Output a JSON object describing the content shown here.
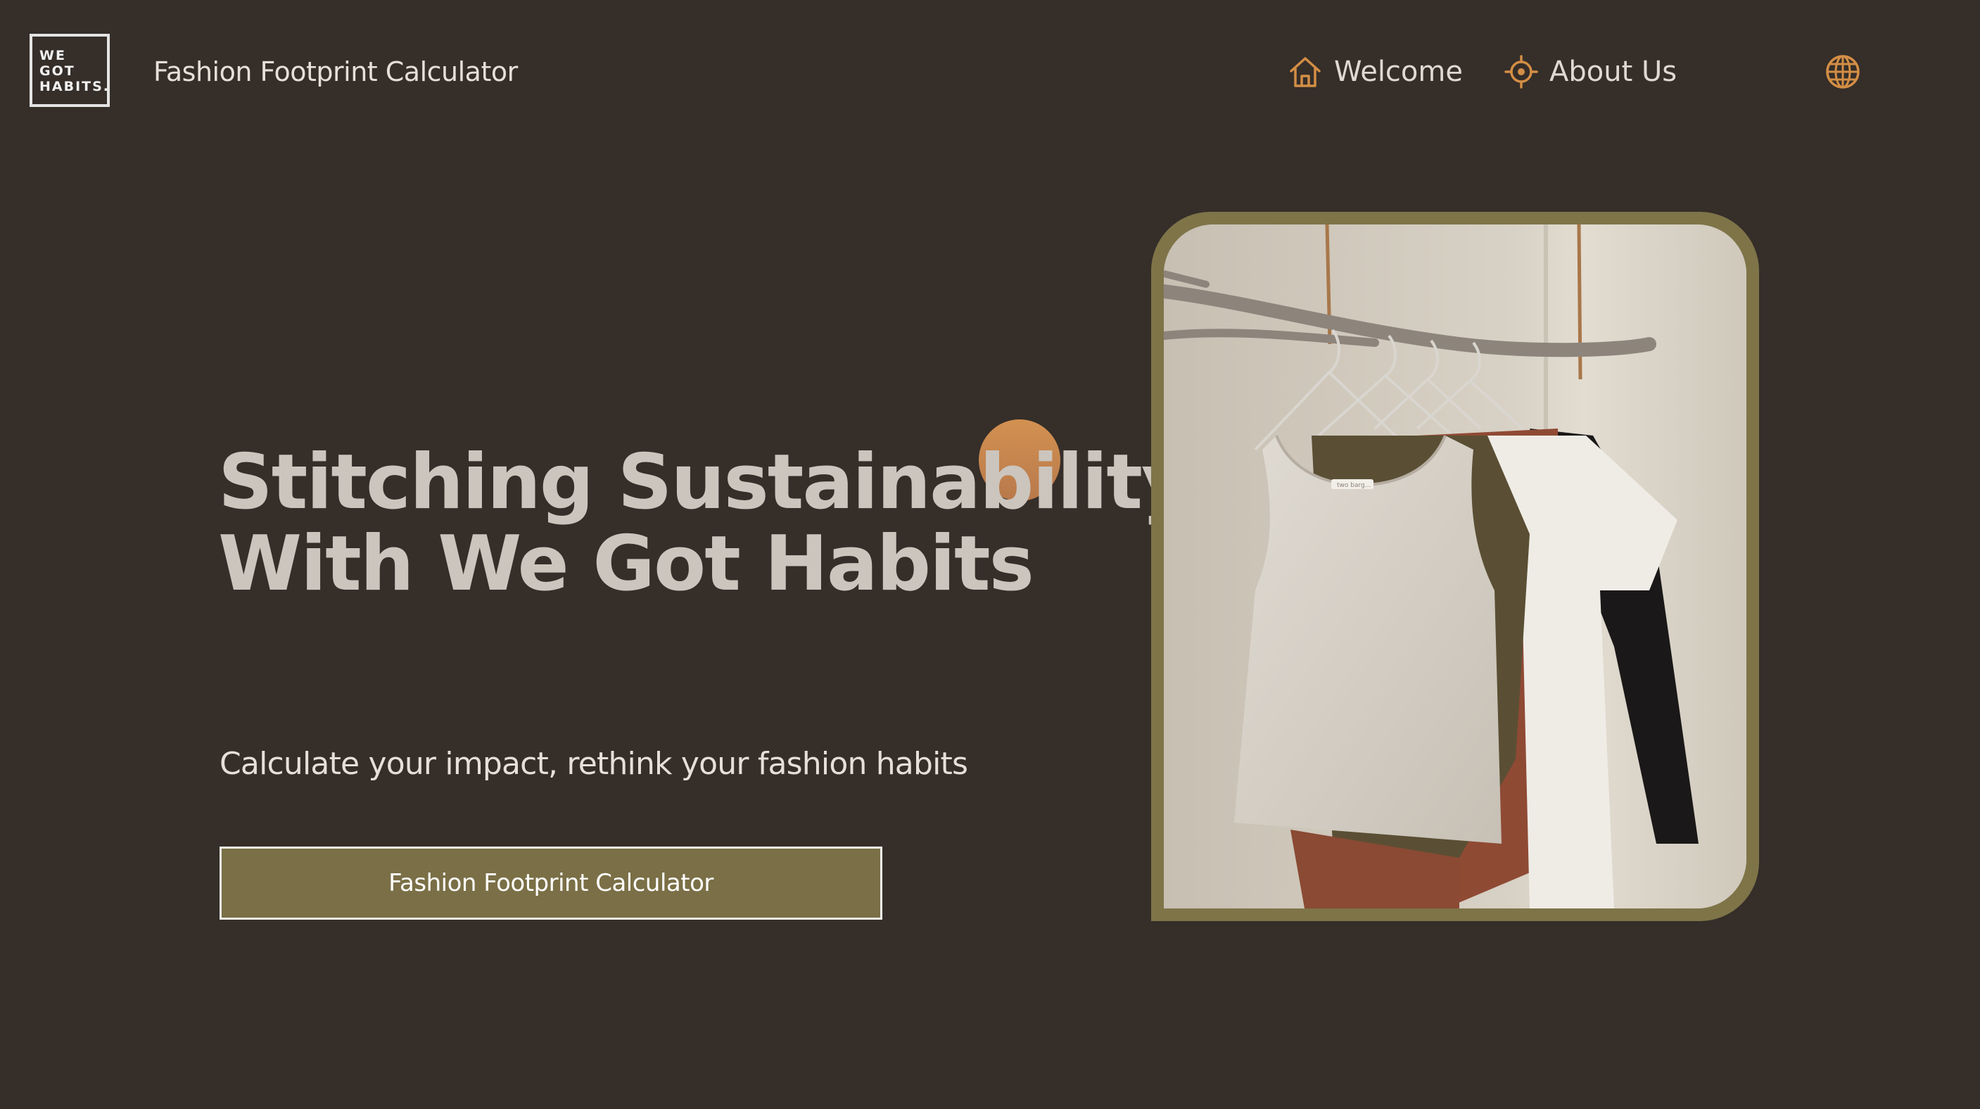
{
  "header": {
    "logo_lines": [
      "WE",
      "GOT",
      "HABITS."
    ],
    "site_title": "Fashion Footprint Calculator",
    "nav": [
      {
        "label": "Welcome",
        "icon": "home-icon"
      },
      {
        "label": "About Us",
        "icon": "target-icon"
      }
    ],
    "language_icon": "globe-icon"
  },
  "hero": {
    "title_line1": "Stitching Sustainability",
    "title_line2": "With We Got Habits",
    "subtitle": "Calculate your impact, rethink your fashion habits",
    "cta_label": "Fashion Footprint Calculator",
    "image_label": "two barg..."
  },
  "colors": {
    "background": "#352e29",
    "accent_olive": "#7a6f46",
    "accent_orange": "#d39150",
    "heading_text": "#cbc5be"
  }
}
